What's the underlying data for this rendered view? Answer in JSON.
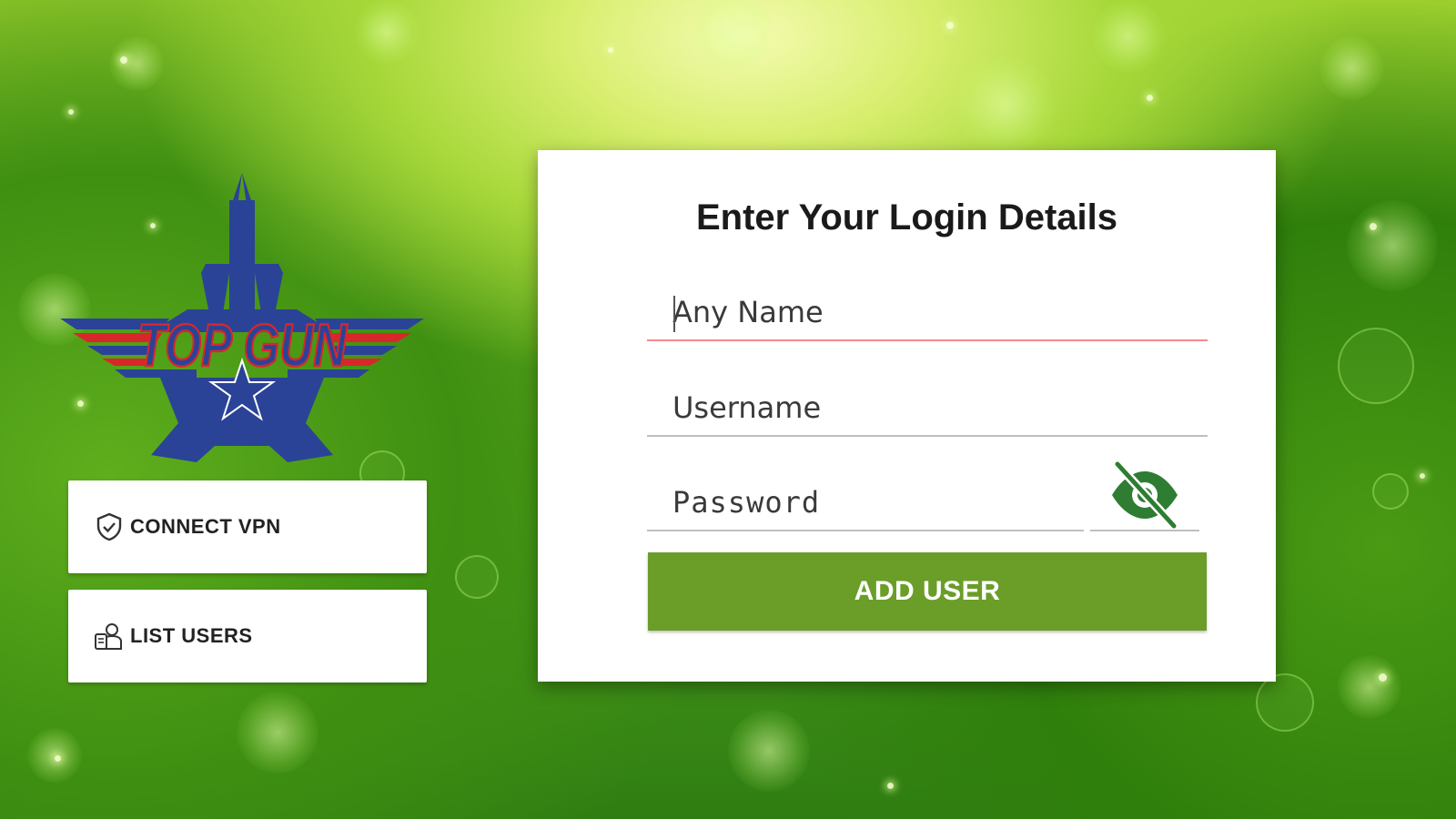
{
  "brand": {
    "logo_text": "TOP GUN",
    "logo_colors": {
      "navy": "#2a4396",
      "red": "#d8272a"
    }
  },
  "sidebar": {
    "connect_vpn": {
      "label": "CONNECT VPN",
      "icon": "shield-check-icon"
    },
    "list_users": {
      "label": "LIST USERS",
      "icon": "users-icon"
    }
  },
  "login": {
    "title": "Enter Your Login Details",
    "name_placeholder": "Any Name",
    "username_placeholder": "Username",
    "password_placeholder": "Password",
    "password_visibility_icon": "eye-off-icon",
    "submit_label": "ADD USER"
  },
  "colors": {
    "accent": "#6a9e28",
    "focused_underline": "#f08a8a",
    "eye_icon": "#2e7d32"
  }
}
